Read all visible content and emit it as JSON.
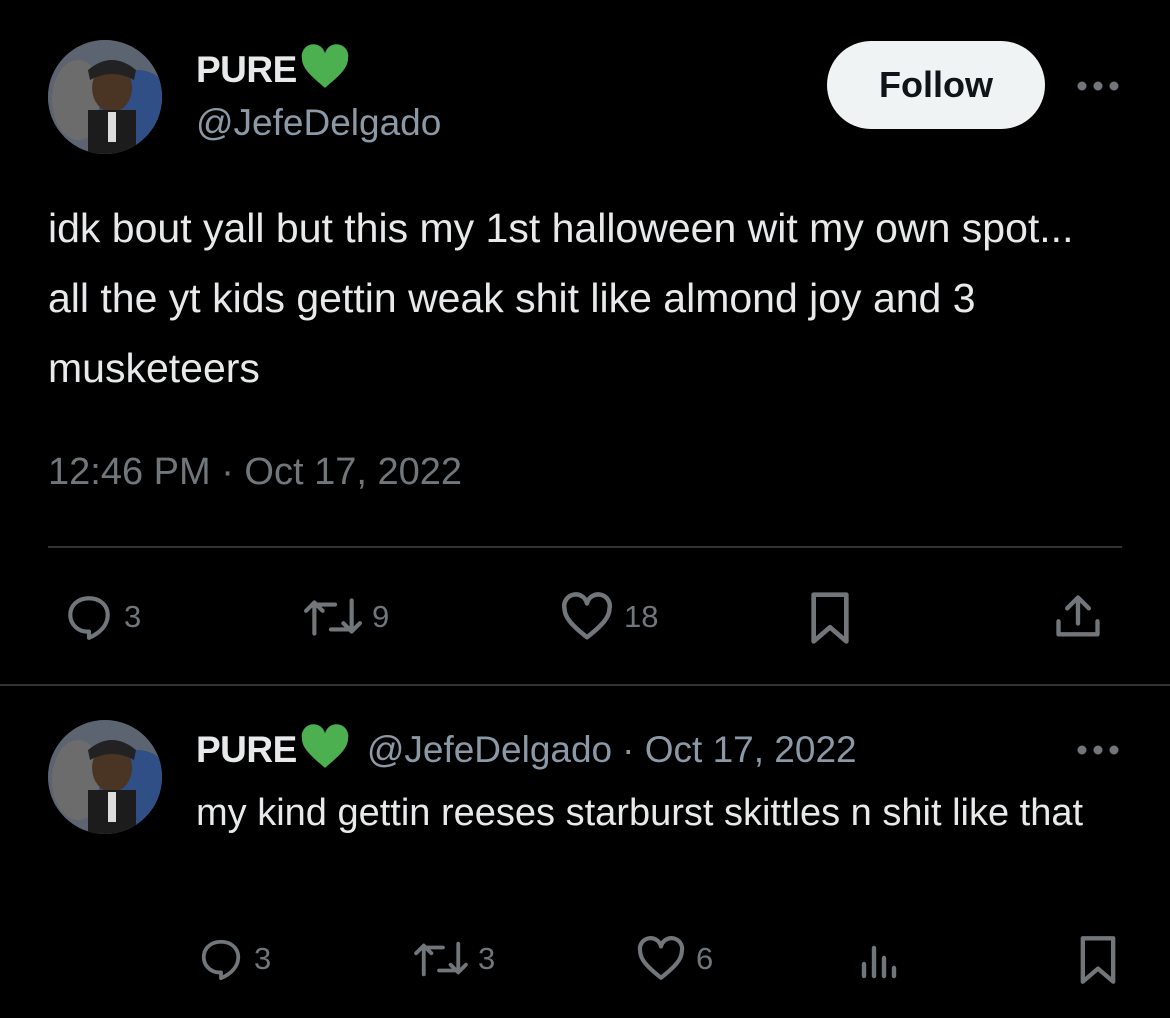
{
  "main_tweet": {
    "author": {
      "name": "PURE",
      "handle": "@JefeDelgado"
    },
    "follow_label": "Follow",
    "text": "idk bout yall but this my 1st halloween wit my own spot... all the yt kids gettin weak shit like almond joy and 3 musketeers",
    "timestamp": "12:46 PM · Oct 17, 2022",
    "actions": {
      "replies": "3",
      "retweets": "9",
      "likes": "18"
    }
  },
  "reply_tweet": {
    "author": {
      "name": "PURE",
      "handle": "@JefeDelgado"
    },
    "date": "· Oct 17, 2022",
    "text": "my kind gettin reeses starburst skittles n shit like that",
    "actions": {
      "replies": "3",
      "retweets": "3",
      "likes": "6"
    }
  },
  "colors": {
    "background": "#000000",
    "heart_badge": "#4caf50",
    "secondary_text": "#71767b",
    "follow_button": "#eff3f4"
  },
  "icons": [
    "reply-icon",
    "retweet-icon",
    "like-icon",
    "bookmark-icon",
    "share-icon",
    "views-icon",
    "more-icon",
    "green-heart-icon"
  ]
}
